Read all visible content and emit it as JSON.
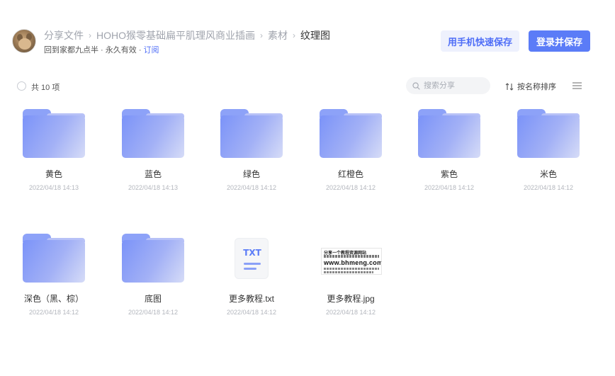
{
  "breadcrumb": {
    "items": [
      "分享文件",
      "HOHO猴零基础扁平肌理风商业插画",
      "素材",
      "纹理图"
    ],
    "separator": "›"
  },
  "share_info": {
    "owner_and_validity": "回到家都九点半 · 永久有效 · ",
    "subscribe_label": "订阅"
  },
  "buttons": {
    "save_with_phone": "用手机快速保存",
    "login_and_save": "登录并保存"
  },
  "toolbar": {
    "count_label": "共 10 项",
    "search_placeholder": "搜索分享",
    "sort_label": "按名称排序"
  },
  "files": [
    {
      "name": "黄色",
      "date": "2022/04/18 14:13",
      "type": "folder"
    },
    {
      "name": "蓝色",
      "date": "2022/04/18 14:13",
      "type": "folder"
    },
    {
      "name": "绿色",
      "date": "2022/04/18 14:12",
      "type": "folder"
    },
    {
      "name": "红橙色",
      "date": "2022/04/18 14:12",
      "type": "folder"
    },
    {
      "name": "紫色",
      "date": "2022/04/18 14:12",
      "type": "folder"
    },
    {
      "name": "米色",
      "date": "2022/04/18 14:12",
      "type": "folder"
    },
    {
      "name": "深色（黑、棕）",
      "date": "2022/04/18 14:12",
      "type": "folder"
    },
    {
      "name": "底图",
      "date": "2022/04/18 14:12",
      "type": "folder"
    },
    {
      "name": "更多教程.txt",
      "date": "2022/04/18 14:12",
      "type": "txt",
      "badge": "TXT"
    },
    {
      "name": "更多教程.jpg",
      "date": "2022/04/18 14:12",
      "type": "jpg",
      "thumb_text_top": "分享一个教程资源网站",
      "thumb_text_main": "www.bhmeng.com"
    }
  ],
  "colors": {
    "accent": "#5b7cf7",
    "accent_light": "#eef1fd",
    "folder_start": "#7b93f8",
    "folder_end": "#d6dcf7"
  }
}
